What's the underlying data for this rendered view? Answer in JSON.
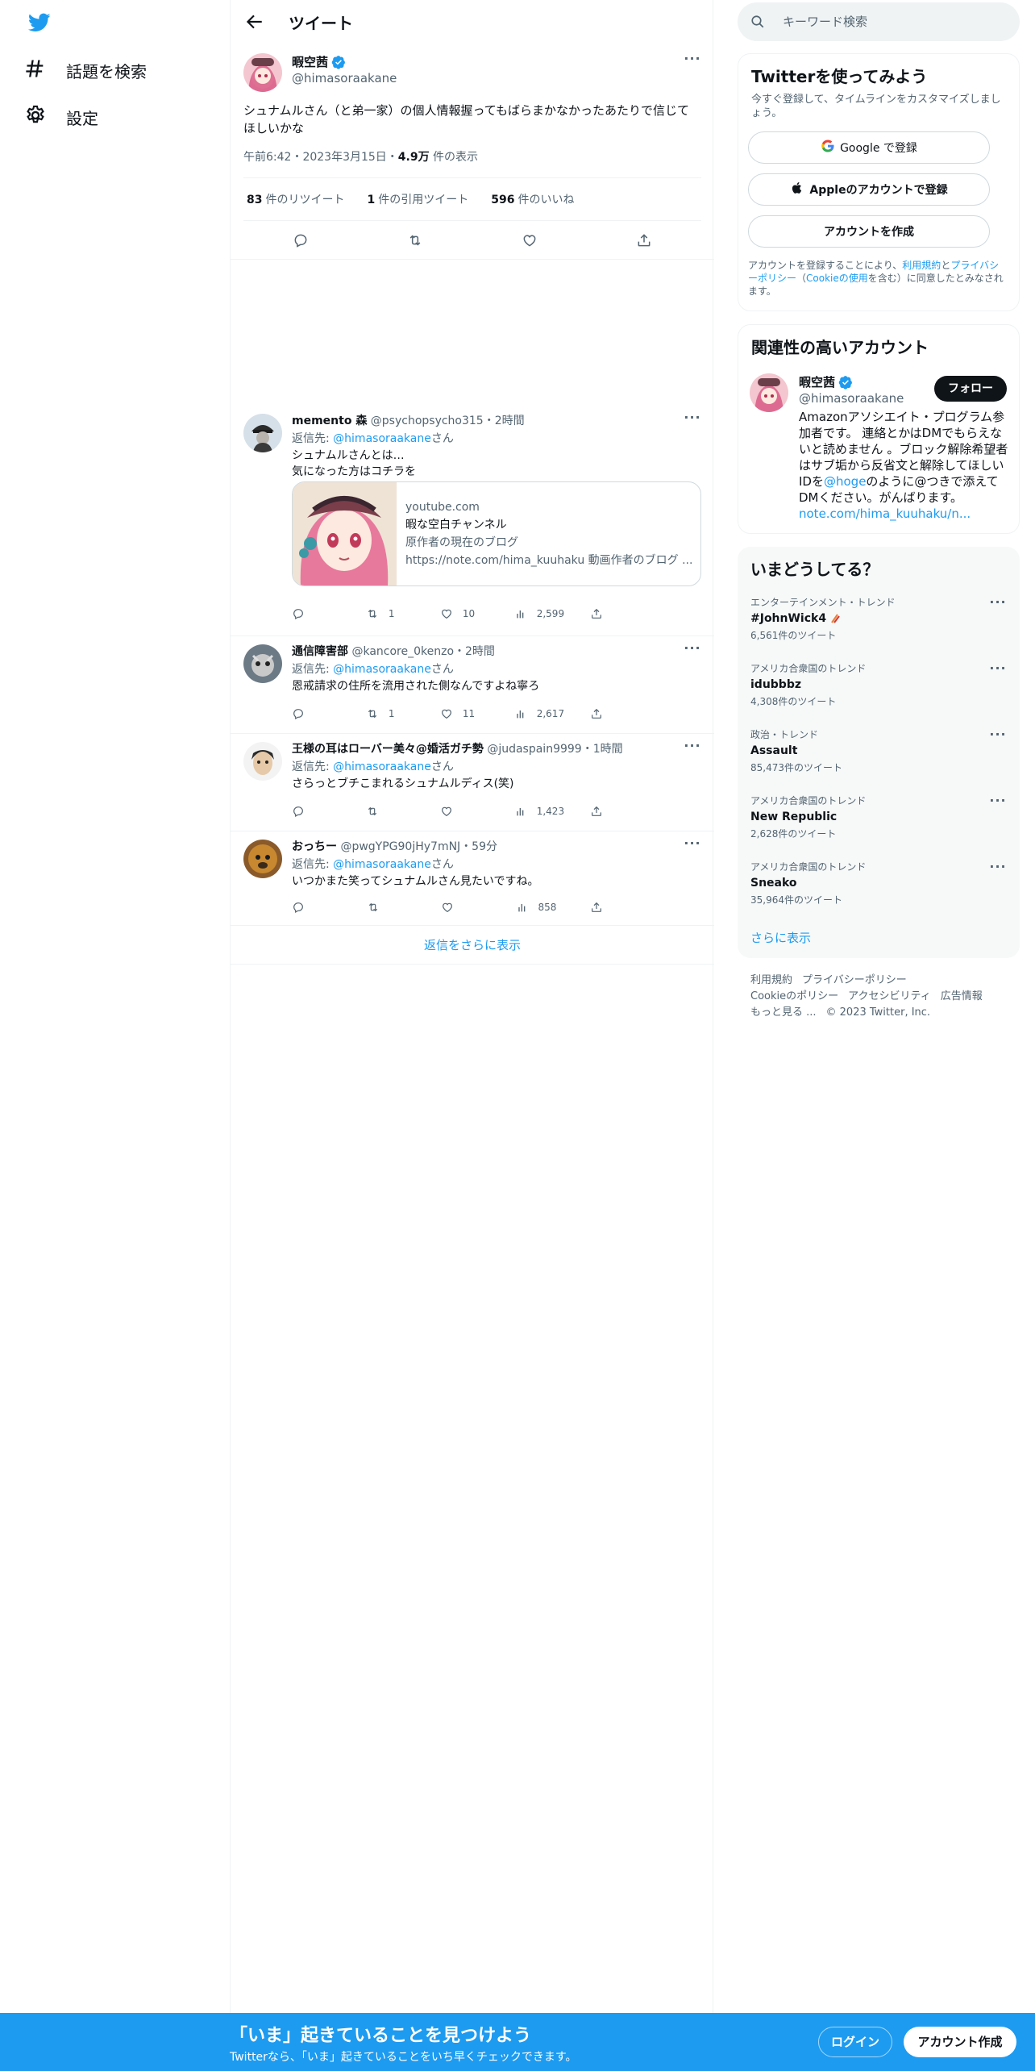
{
  "nav": {
    "items": [
      {
        "label": "話題を検索",
        "icon": "hashtag-icon"
      },
      {
        "label": "設定",
        "icon": "gear-icon"
      }
    ]
  },
  "header": {
    "title": "ツイート"
  },
  "main_tweet": {
    "name": "暇空茜",
    "handle": "@himasoraakane",
    "text": "シュナムルさん（と弟一家）の個人情報握ってもばらまかなかったあたりで信じてほしいかな",
    "time": "午前6:42・2023年3月15日・",
    "views_count": "4.9万",
    "views_label": " 件の表示",
    "retweets_count": "83",
    "retweets_label": "件のリツイート",
    "quotes_count": "1",
    "quotes_label": "件の引用ツイート",
    "likes_count": "596",
    "likes_label": "件のいいね"
  },
  "replies": [
    {
      "name": "memento 森",
      "handle": "@psychopsycho315",
      "time": "・2時間",
      "to_prefix": "返信先: ",
      "to": "@himasoraakane",
      "to_suffix": "さん",
      "text_lines": [
        "シュナムルさんとは…",
        "気になった方はコチラを"
      ],
      "card": {
        "domain": "youtube.com",
        "title": "暇な空白チャンネル",
        "desc1": "原作者の現在のブログ",
        "desc2": "https://note.com/hima_kuuhaku 動画作者のブログ ..."
      },
      "retweets": "1",
      "likes": "10",
      "views": "2,599"
    },
    {
      "name": "通信障害部",
      "handle": "@kancore_0kenzo",
      "time": "・2時間",
      "to_prefix": "返信先: ",
      "to": "@himasoraakane",
      "to_suffix": "さん",
      "text_lines": [
        "恩戒請求の住所を流用された側なんですよね寧ろ"
      ],
      "retweets": "1",
      "likes": "11",
      "views": "2,617"
    },
    {
      "name": "王様の耳はローバー美々@婚活ガチ勢",
      "handle": "@judaspain9999",
      "time": "・1時間",
      "to_prefix": "返信先: ",
      "to": "@himasoraakane",
      "to_suffix": "さん",
      "text_lines": [
        "さらっとブチこまれるシュナムルディス(笑)"
      ],
      "retweets": "",
      "likes": "",
      "views": "1,423"
    },
    {
      "name": "おっちー",
      "handle": "@pwgYPG90jHy7mNJ",
      "time": "・59分",
      "to_prefix": "返信先: ",
      "to": "@himasoraakane",
      "to_suffix": "さん",
      "text_lines": [
        "いつかまた笑ってシュナムルさん見たいですね。"
      ],
      "retweets": "",
      "likes": "",
      "views": "858"
    }
  ],
  "show_more": "返信をさらに表示",
  "search": {
    "placeholder": "キーワード検索"
  },
  "signup_box": {
    "title": "Twitterを使ってみよう",
    "desc": "今すぐ登録して、タイムラインをカスタマイズしましょう。",
    "google": "Google で登録",
    "apple": "Appleのアカウントで登録",
    "create": "アカウントを作成",
    "legal_1": "アカウントを登録することにより、",
    "legal_terms": "利用規約",
    "legal_2": "と",
    "legal_privacy": "プライバシーポリシー",
    "legal_3": "（",
    "legal_cookie": "Cookieの使用",
    "legal_4": "を含む）に同意したとみなされます。"
  },
  "related": {
    "title": "関連性の高いアカウント",
    "name": "暇空茜",
    "handle": "@himasoraakane",
    "follow": "フォロー",
    "bio_1": "Amazonアソシエイト・プログラム参加者です。 連絡とかはDMでもらえないと読めません 。ブロック解除希望者はサブ垢から反省文と解除してほしいIDを",
    "bio_hoge": "@hoge",
    "bio_2": "のように@つきで添えてDMください。がんばります。",
    "bio_link": "note.com/hima_kuuhaku/n..."
  },
  "trends": {
    "title": "いまどうしてる？",
    "items": [
      {
        "context": "エンターテインメント・トレンド",
        "name": "#JohnWick4",
        "count": "6,561件のツイート"
      },
      {
        "context": "アメリカ合衆国のトレンド",
        "name": "idubbbz",
        "count": "4,308件のツイート"
      },
      {
        "context": "政治・トレンド",
        "name": "Assault",
        "count": "85,473件のツイート"
      },
      {
        "context": "アメリカ合衆国のトレンド",
        "name": "New Republic",
        "count": "2,628件のツイート"
      },
      {
        "context": "アメリカ合衆国のトレンド",
        "name": "Sneako",
        "count": "35,964件のツイート"
      }
    ],
    "more": "さらに表示"
  },
  "footer": {
    "terms": "利用規約",
    "privacy": "プライバシーポリシー",
    "cookie": "Cookieのポリシー",
    "accessibility": "アクセシビリティ",
    "ads": "広告情報",
    "more": "もっと見る ...",
    "copyright": "© 2023 Twitter, Inc."
  },
  "banner": {
    "headline": "「いま」起きていることを見つけよう",
    "sub": "Twitterなら、「いま」起きていることをいち早くチェックできます。",
    "login": "ログイン",
    "signup": "アカウント作成"
  },
  "colors": {
    "accent": "#1d9bf0",
    "text": "#0f1419",
    "muted": "#536471",
    "border": "#eff3f4"
  }
}
